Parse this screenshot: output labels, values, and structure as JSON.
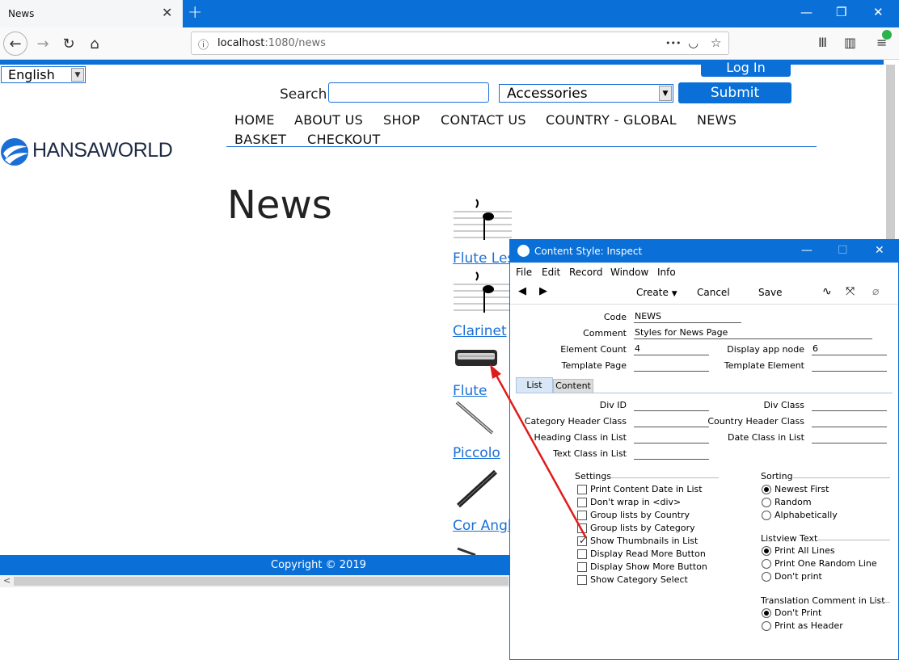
{
  "browser": {
    "tab_title": "News",
    "tab_close": "✕",
    "new_tab": "+",
    "url_host": "localhost",
    "url_path": ":1080/news",
    "url_dots": "•••"
  },
  "page": {
    "language": "English",
    "login": "Log In",
    "search_label": "Search",
    "search_value": "",
    "category": "Accessories",
    "submit": "Submit",
    "menu": [
      "HOME",
      "ABOUT US",
      "SHOP",
      "CONTACT US",
      "COUNTRY - GLOBAL",
      "NEWS",
      "BASKET",
      "CHECKOUT"
    ],
    "logo_text": "HANSAWORLD",
    "heading": "News",
    "news_items": [
      "Flute Les",
      "Clarinet",
      "Flute",
      "Piccolo",
      "Cor Angl"
    ],
    "copyright": "Copyright © 2019"
  },
  "dialog": {
    "title": "Content Style: Inspect",
    "menus": [
      "File",
      "Edit",
      "Record",
      "Window",
      "Info"
    ],
    "toolbar": {
      "create": "Create",
      "cancel": "Cancel",
      "save": "Save"
    },
    "fields": {
      "code_label": "Code",
      "code_value": "NEWS",
      "comment_label": "Comment",
      "comment_value": "Styles for News Page",
      "element_count_label": "Element Count",
      "element_count_value": "4",
      "display_app_node_label": "Display app node",
      "display_app_node_value": "6",
      "template_page_label": "Template Page",
      "template_page_value": "",
      "template_element_label": "Template Element",
      "template_element_value": ""
    },
    "tabs": [
      "List",
      "Content"
    ],
    "list_fields": {
      "div_id": "Div ID",
      "div_class": "Div Class",
      "category_header_class": "Category Header Class",
      "country_header_class": "Country Header Class",
      "heading_class": "Heading Class in List",
      "date_class": "Date Class in List",
      "text_class": "Text Class in List"
    },
    "settings": {
      "title": "Settings",
      "options": [
        {
          "label": "Print Content Date in List",
          "checked": false
        },
        {
          "label": "Don't wrap in <div>",
          "checked": false
        },
        {
          "label": "Group lists by Country",
          "checked": false
        },
        {
          "label": "Group lists by Category",
          "checked": false
        },
        {
          "label": "Show Thumbnails in List",
          "checked": true
        },
        {
          "label": "Display Read More Button",
          "checked": false
        },
        {
          "label": "Display Show More Button",
          "checked": false
        },
        {
          "label": "Show Category Select",
          "checked": false
        }
      ]
    },
    "sorting": {
      "title": "Sorting",
      "options": [
        {
          "label": "Newest First",
          "selected": true
        },
        {
          "label": "Random",
          "selected": false
        },
        {
          "label": "Alphabetically",
          "selected": false
        }
      ]
    },
    "listview_text": {
      "title": "Listview Text",
      "options": [
        {
          "label": "Print All Lines",
          "selected": true
        },
        {
          "label": "Print One Random Line",
          "selected": false
        },
        {
          "label": "Don't print",
          "selected": false
        }
      ]
    },
    "translation_comment": {
      "title": "Translation Comment in List",
      "options": [
        {
          "label": "Don't Print",
          "selected": true
        },
        {
          "label": "Print as Header",
          "selected": false
        }
      ]
    }
  },
  "colors": {
    "brand_blue": "#0a6fd6",
    "arrow_red": "#e01b1b"
  }
}
